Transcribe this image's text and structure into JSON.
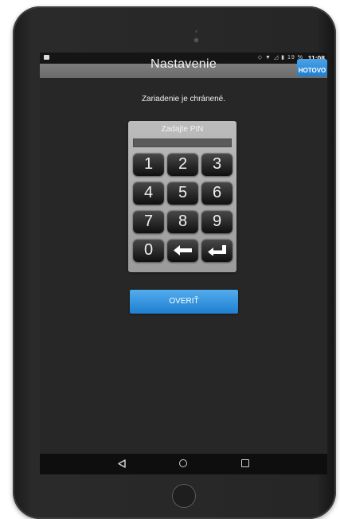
{
  "status_bar": {
    "battery_percent": "19 %",
    "time": "11:08",
    "icons": [
      "notification-icon",
      "vibrate-icon",
      "wifi-icon",
      "signal-icon",
      "battery-icon"
    ]
  },
  "title_bar": {
    "title": "Nastavenie",
    "done_label": "HOTOVO"
  },
  "message": "Zariadenie je chránené.",
  "pinpad": {
    "label": "Zadajte PIN",
    "pin_value": "",
    "keys": [
      "1",
      "2",
      "3",
      "4",
      "5",
      "6",
      "7",
      "8",
      "9",
      "0"
    ]
  },
  "verify_label": "OVERIŤ",
  "nav": {
    "icons": [
      "back-icon",
      "home-icon",
      "recent-apps-icon"
    ]
  },
  "colors": {
    "accent": "#2b8ad8",
    "screen_bg": "#272727",
    "title_bar": "#757575",
    "pinpad_bg": "#aaaaaa"
  }
}
